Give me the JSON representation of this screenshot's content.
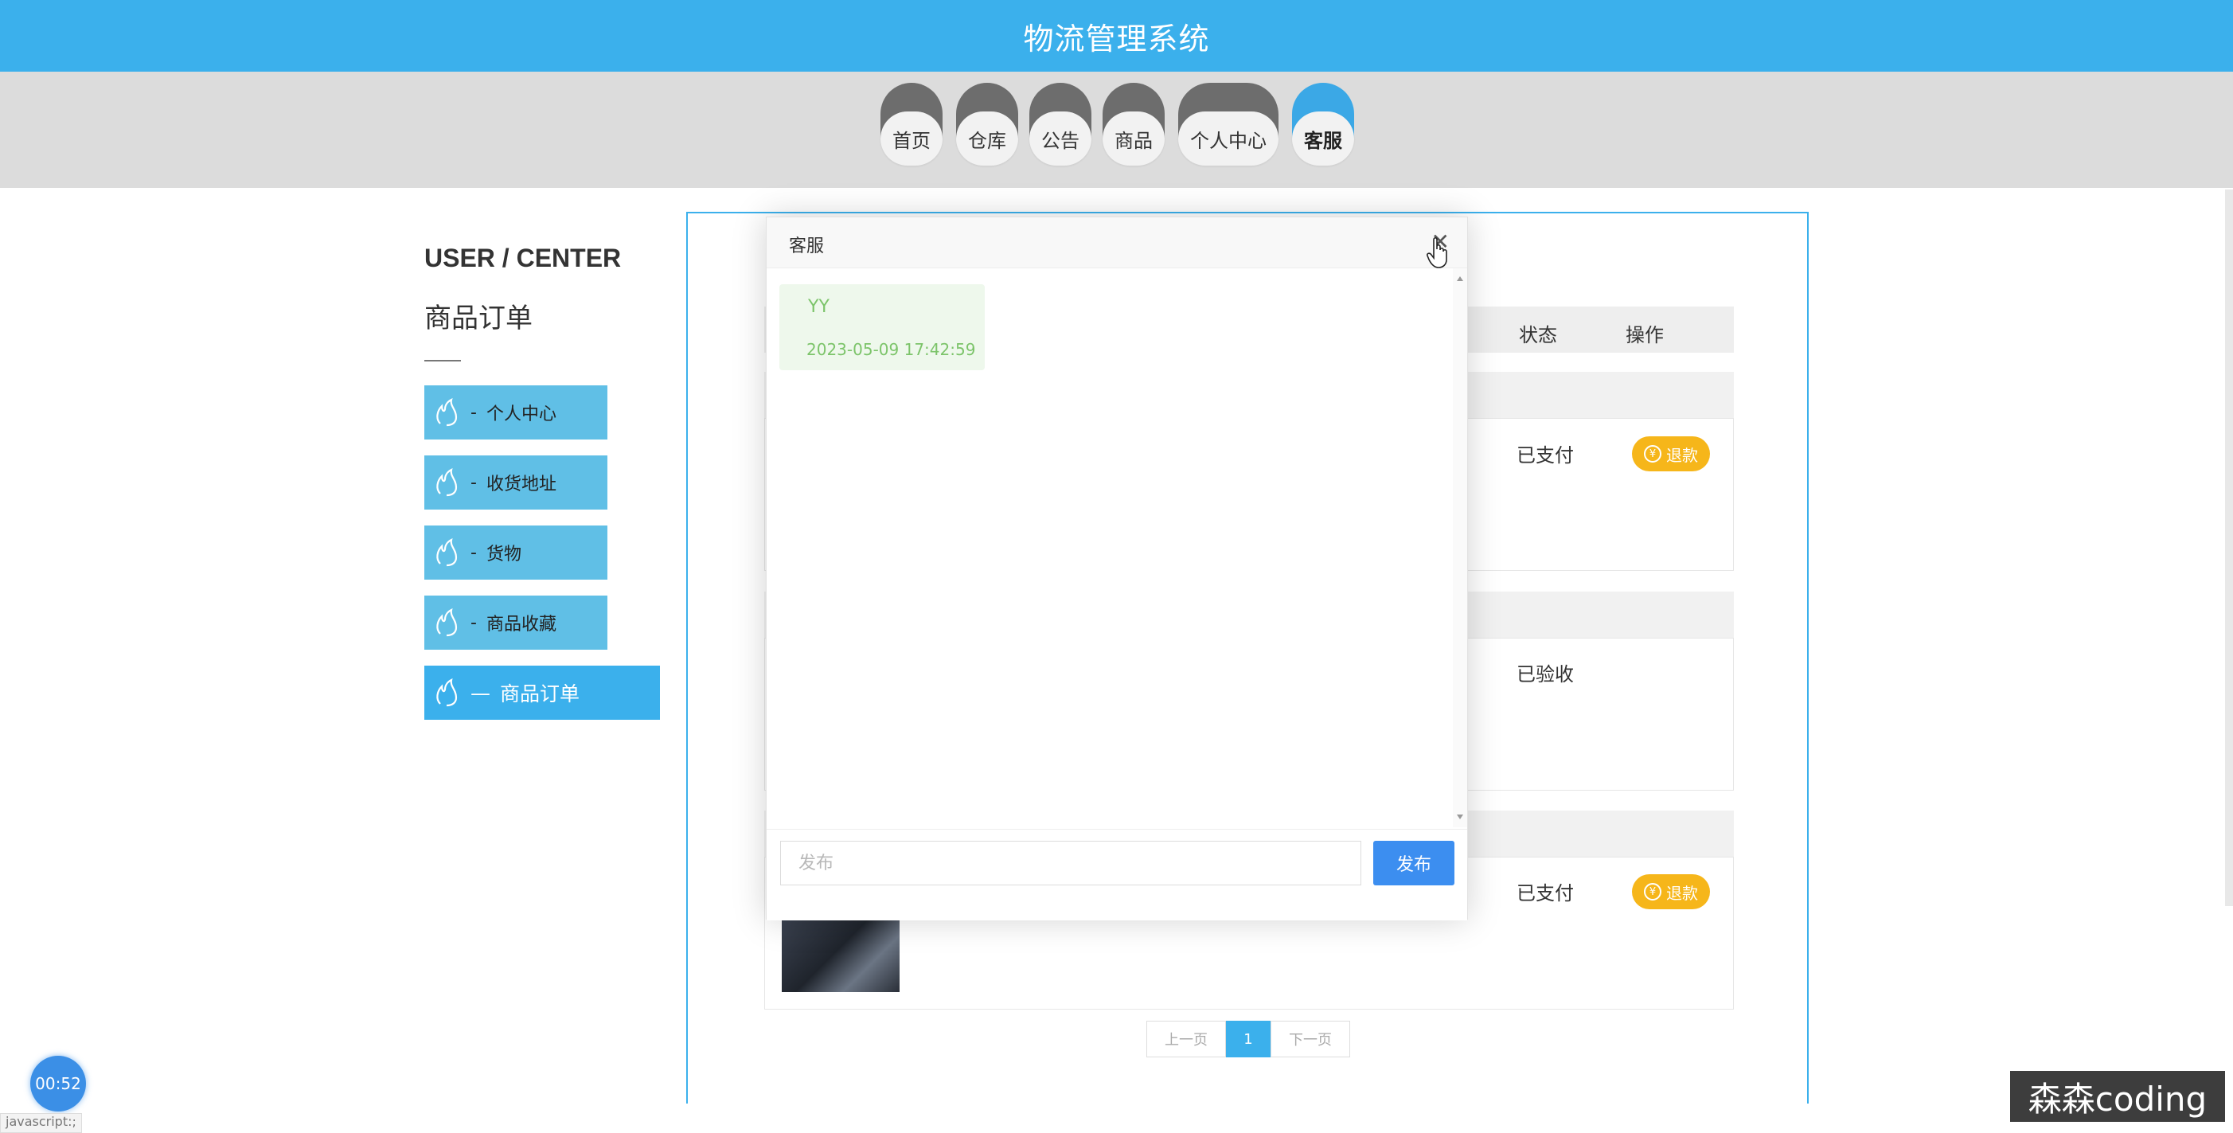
{
  "header": {
    "title": "物流管理系统"
  },
  "nav": {
    "items": [
      {
        "label": "首页"
      },
      {
        "label": "仓库"
      },
      {
        "label": "公告"
      },
      {
        "label": "商品"
      },
      {
        "label": "个人中心"
      },
      {
        "label": "客服",
        "active": true
      }
    ]
  },
  "sidebar": {
    "title": "USER / CENTER",
    "subtitle": "商品订单",
    "items": [
      {
        "label": "个人中心",
        "prefix": "-",
        "icon": "flame-icon"
      },
      {
        "label": "收货地址",
        "prefix": "-",
        "icon": "flame-icon"
      },
      {
        "label": "货物",
        "prefix": "-",
        "icon": "flame-icon"
      },
      {
        "label": "商品收藏",
        "prefix": "-",
        "icon": "flame-icon"
      },
      {
        "label": "商品订单",
        "prefix": "—",
        "icon": "flame-icon",
        "active": true
      }
    ]
  },
  "table": {
    "headers": {
      "status": "状态",
      "action": "操作"
    },
    "orders": [
      {
        "status": "已支付",
        "action": "退款"
      },
      {
        "status": "已验收"
      },
      {
        "status": "已支付",
        "action": "退款"
      }
    ]
  },
  "pagination": {
    "prev": "上一页",
    "current": "1",
    "next": "下一页"
  },
  "chat": {
    "title": "客服",
    "close_icon": "close-icon",
    "messages": [
      {
        "sender": "YY",
        "time": "2023-05-09 17:42:59"
      }
    ],
    "input_placeholder": "发布",
    "send_label": "发布"
  },
  "overlay": {
    "timer": "00:52",
    "status_url": "javascript:;",
    "watermark": "森森coding"
  },
  "colors": {
    "primary": "#3bb0ec",
    "sidebar_item": "#60bfe6",
    "refund": "#f6b61a",
    "send_button": "#3c8ef0",
    "bubble_bg": "#eef8ec",
    "bubble_text": "#7cc46a"
  }
}
